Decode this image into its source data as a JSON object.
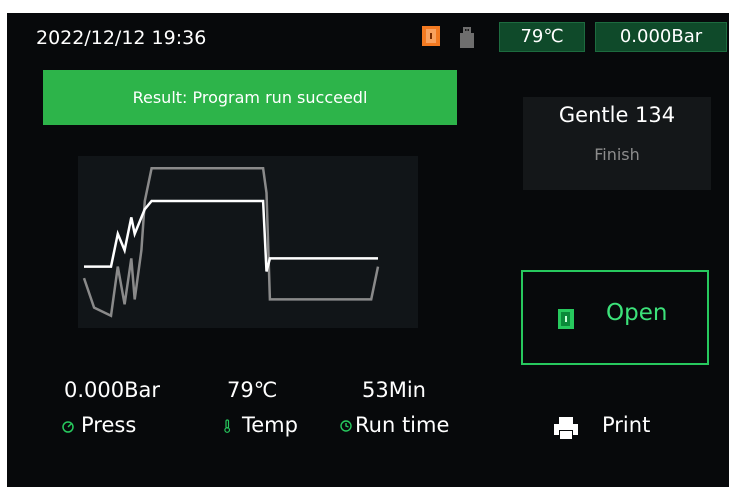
{
  "status_bar": {
    "datetime": "2022/12/12   19:36",
    "temperature": "79℃",
    "pressure": "0.000Bar",
    "icons": [
      "door-open-icon",
      "usb-icon"
    ]
  },
  "result_banner": {
    "text": "Result: Program run succeedl",
    "color": "#2db44a"
  },
  "program": {
    "name": "Gentle 134",
    "status": "Finish"
  },
  "chart_data": {
    "type": "line",
    "title": "",
    "xlabel": "",
    "ylabel": "",
    "grid": false,
    "x": [
      0,
      3,
      8,
      10,
      12,
      14,
      15,
      17,
      18,
      20,
      24,
      27,
      30,
      53,
      54,
      55,
      85,
      87
    ],
    "series": [
      {
        "color": "#ffffff",
        "values": [
          0.35,
          0.35,
          0.35,
          0.55,
          0.45,
          0.65,
          0.55,
          0.65,
          0.7,
          0.75,
          0.75,
          0.75,
          0.75,
          0.75,
          0.32,
          0.4,
          0.4,
          0.4
        ]
      },
      {
        "color": "#8a8a8a",
        "values": [
          0.28,
          0.1,
          0.05,
          0.35,
          0.12,
          0.4,
          0.15,
          0.45,
          0.75,
          0.95,
          0.95,
          0.95,
          0.95,
          0.95,
          0.8,
          0.15,
          0.15,
          0.35
        ]
      }
    ]
  },
  "open_button": {
    "label": "Open",
    "accent": "#3ce27a"
  },
  "readouts": {
    "pressure": {
      "value": "0.000Bar",
      "label": "Press"
    },
    "temperature": {
      "value": "79℃",
      "label": "Temp"
    },
    "run_time": {
      "value": "53Min",
      "label": "Run time"
    }
  },
  "print_button": {
    "label": "Print"
  }
}
